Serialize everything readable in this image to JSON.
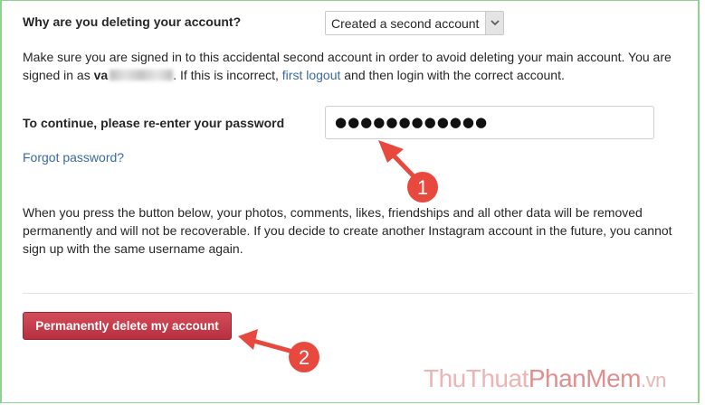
{
  "question": {
    "label": "Why are you deleting your account?",
    "selected_reason": "Created a second account"
  },
  "info": {
    "text_before": "Make sure you are signed in to this accidental second account in order to avoid deleting your main account. You are signed in as ",
    "username_visible": "va",
    "text_middle": ". If this is incorrect, ",
    "logout_link": "first logout",
    "text_after": " and then login with the correct account."
  },
  "password": {
    "label": "To continue, please re-enter your password",
    "masked_value": "●●●●●●●●●●●●"
  },
  "forgot_link": "Forgot password?",
  "warning": "When you press the button below, your photos, comments, likes, friendships and all other data will be removed permanently and will not be recoverable. If you decide to create another Instagram account in the future, you cannot sign up with the same username again.",
  "delete_button": "Permanently delete my account",
  "annotations": {
    "step1": "1",
    "step2": "2",
    "accent_color": "#e8493f"
  },
  "watermark": {
    "part1": "ThuThuat",
    "part2": "PhanMem",
    "part3": ".vn"
  },
  "icons": {
    "select_arrow": "chevron-down-icon"
  }
}
